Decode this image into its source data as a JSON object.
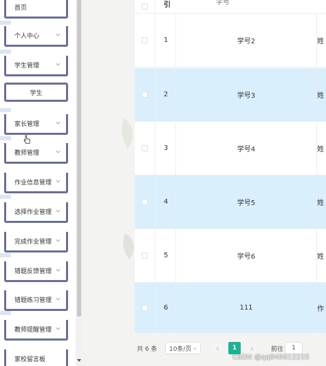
{
  "sidebar": {
    "items": [
      {
        "label": "首页",
        "chevron": false
      },
      {
        "label": "个人中心",
        "chevron": true
      },
      {
        "label": "学生管理",
        "chevron": true
      },
      {
        "label": "学生",
        "chevron": false,
        "sub": true
      },
      {
        "label": "家长管理",
        "chevron": true
      },
      {
        "label": "教师管理",
        "chevron": true
      },
      {
        "label": "作业信息管理",
        "chevron": true
      },
      {
        "label": "选择作业管理",
        "chevron": true
      },
      {
        "label": "完成作业管理",
        "chevron": true
      },
      {
        "label": "错题反馈管理",
        "chevron": true
      },
      {
        "label": "错题练习管理",
        "chevron": true
      },
      {
        "label": "教师提醒管理",
        "chevron": true
      },
      {
        "label": "家校留言板",
        "chevron": false
      }
    ]
  },
  "table": {
    "header": {
      "index": "引",
      "student_no": "学号"
    },
    "rows": [
      {
        "index": "1",
        "student_no": "学号2",
        "name": "姓",
        "highlight": false
      },
      {
        "index": "2",
        "student_no": "学号3",
        "name": "姓",
        "highlight": true
      },
      {
        "index": "3",
        "student_no": "学号4",
        "name": "姓",
        "highlight": false
      },
      {
        "index": "4",
        "student_no": "学号5",
        "name": "姓",
        "highlight": true
      },
      {
        "index": "5",
        "student_no": "学号6",
        "name": "姓",
        "highlight": false
      },
      {
        "index": "6",
        "student_no": "111",
        "name": "作",
        "highlight": true
      }
    ]
  },
  "pagination": {
    "total": "共 6 条",
    "page_size": "10条/页",
    "current_page": "1",
    "goto_label": "前往",
    "goto_value": "1"
  },
  "watermark": "CSDN @qq840612233",
  "colors": {
    "accent": "#1bb394",
    "row_highlight": "#d9effc",
    "nav_border": "#6b6f96"
  }
}
